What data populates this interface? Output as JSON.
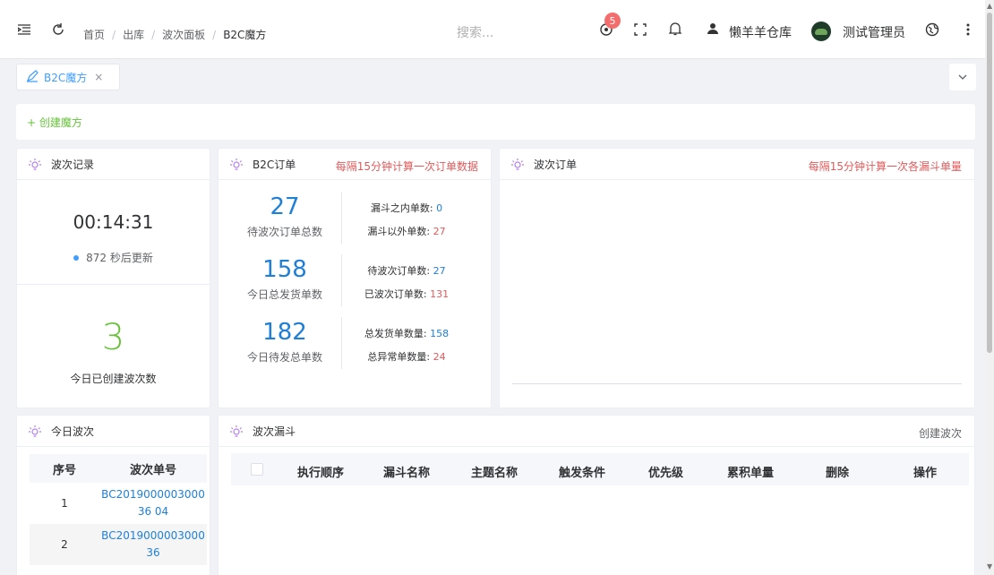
{
  "header": {
    "breadcrumb": [
      "首页",
      "出库",
      "波次面板",
      "B2C魔方"
    ],
    "search_placeholder": "搜索...",
    "notification_count": "5",
    "warehouse": "懒羊羊仓库",
    "user": "测试管理员"
  },
  "tabs": [
    {
      "label": "B2C魔方",
      "close": "×"
    }
  ],
  "create_button": "+ 创建魔方",
  "wave_record": {
    "title": "波次记录",
    "timer": "00:14:31",
    "update_text": "872 秒后更新",
    "created_count": "3",
    "created_label": "今日已创建波次数"
  },
  "b2c_orders": {
    "title": "B2C订单",
    "note": "每隔15分钟计算一次订单数据",
    "stats": [
      {
        "value": "27",
        "label": "待波次订单总数"
      },
      {
        "value": "158",
        "label": "今日总发货单数"
      },
      {
        "value": "182",
        "label": "今日待发总单数"
      }
    ],
    "details": [
      {
        "label": "漏斗之内单数: ",
        "value": "0",
        "color": "blue"
      },
      {
        "label": "漏斗以外单数: ",
        "value": "27",
        "color": "red"
      },
      {
        "label": "待波次订单数: ",
        "value": "27",
        "color": "blue"
      },
      {
        "label": "已波次订单数: ",
        "value": "131",
        "color": "red"
      },
      {
        "label": "总发货单数量: ",
        "value": "158",
        "color": "blue"
      },
      {
        "label": "总异常单数量: ",
        "value": "24",
        "color": "red"
      }
    ]
  },
  "wave_orders": {
    "title": "波次订单",
    "note": "每隔15分钟计算一次各漏斗单量"
  },
  "today_waves": {
    "title": "今日波次",
    "columns": [
      "序号",
      "波次单号"
    ],
    "rows": [
      {
        "index": "1",
        "wave_no": "BC201900000300036 04"
      },
      {
        "index": "2",
        "wave_no": "BC201900000300036"
      }
    ]
  },
  "funnel": {
    "title": "波次漏斗",
    "create_label": "创建波次",
    "columns": [
      "执行顺序",
      "漏斗名称",
      "主题名称",
      "触发条件",
      "优先级",
      "累积单量",
      "删除",
      "操作"
    ]
  },
  "colors": {
    "primary": "#409eff",
    "success": "#67c23a",
    "danger": "#e05a5a",
    "value_blue": "#1f7fd6"
  }
}
